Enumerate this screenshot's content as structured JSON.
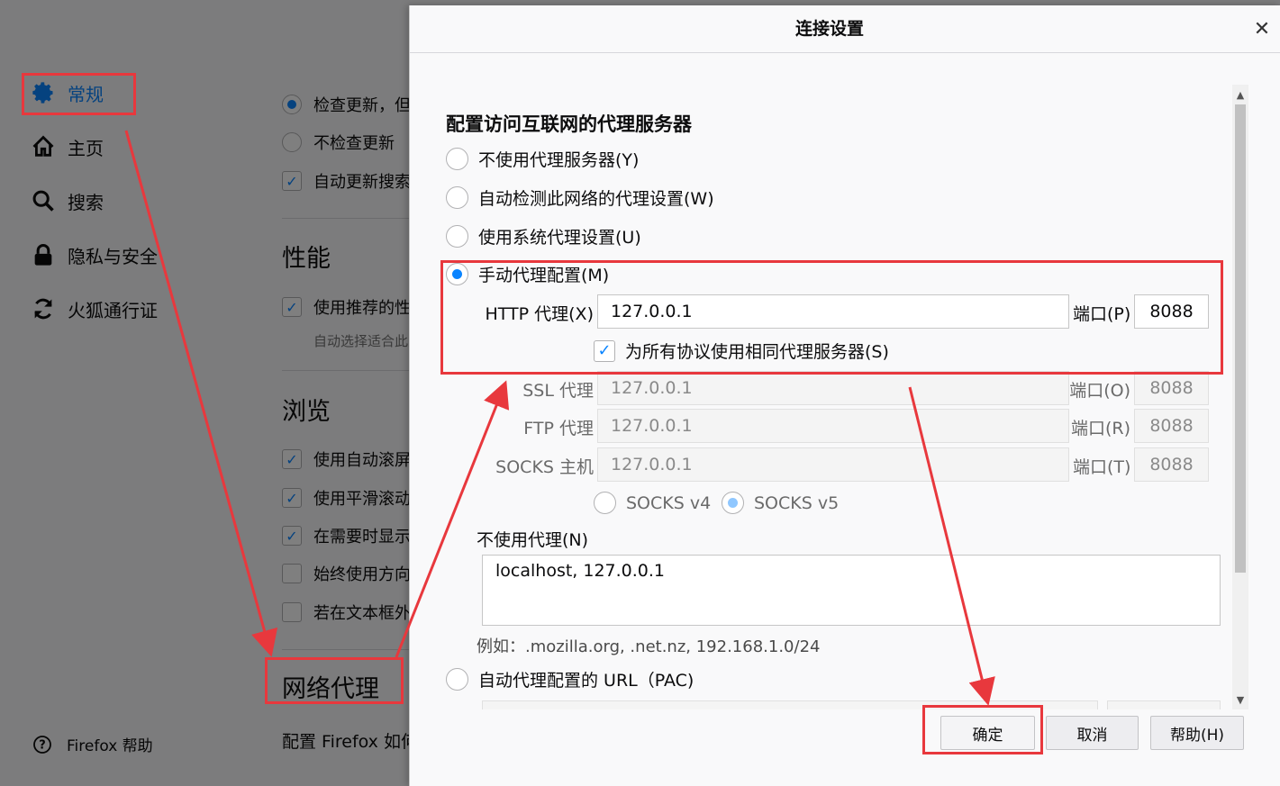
{
  "background": {
    "nav": [
      {
        "label": "常规",
        "icon": "gear-icon",
        "selected": true
      },
      {
        "label": "主页",
        "icon": "home-icon"
      },
      {
        "label": "搜索",
        "icon": "search-icon"
      },
      {
        "label": "隐私与安全",
        "icon": "lock-icon"
      },
      {
        "label": "火狐通行证",
        "icon": "sync-icon"
      }
    ],
    "help": "Firefox 帮助",
    "updates": {
      "opt1": "检查更新，但",
      "opt2": "不检查更新",
      "opt3": "自动更新搜索"
    },
    "performance": {
      "title": "性能",
      "opt1": "使用推荐的性",
      "sub": "自动选择适合此"
    },
    "browsing": {
      "title": "浏览",
      "opt1": "使用自动滚屏",
      "opt2": "使用平滑滚动",
      "opt3": "在需要时显示",
      "opt4": "始终使用方向",
      "opt5": "若在文本框外"
    },
    "proxy": {
      "title": "网络代理",
      "desc": "配置 Firefox 如何"
    }
  },
  "dialog": {
    "title": "连接设置",
    "heading": "配置访问互联网的代理服务器",
    "no_proxy": "不使用代理服务器(Y)",
    "auto_detect": "自动检测此网络的代理设置(W)",
    "system_proxy": "使用系统代理设置(U)",
    "manual_proxy": "手动代理配置(M)",
    "http_label": "HTTP 代理(X)",
    "http_value": "127.0.0.1",
    "port_p_label": "端口(P)",
    "http_port": "8088",
    "same_proxy": "为所有协议使用相同代理服务器(S)",
    "ssl_label": "SSL 代理",
    "ssl_value": "127.0.0.1",
    "port_o_label": "端口(O)",
    "ssl_port": "8088",
    "ftp_label": "FTP 代理",
    "ftp_value": "127.0.0.1",
    "port_r_label": "端口(R)",
    "ftp_port": "8088",
    "socks_label": "SOCKS 主机",
    "socks_value": "127.0.0.1",
    "port_t_label": "端口(T)",
    "socks_port": "8088",
    "socks_v4": "SOCKS v4",
    "socks_v5": "SOCKS v5",
    "no_proxy_for_label": "不使用代理(N)",
    "no_proxy_for_value": "localhost, 127.0.0.1",
    "example": "例如：.mozilla.org, .net.nz, 192.168.1.0/24",
    "pac_url": "自动代理配置的 URL（PAC)",
    "ok": "确定",
    "cancel": "取消",
    "help": "帮助(H)"
  },
  "colors": {
    "accent": "#0a84ff",
    "annotation": "#e8383d"
  }
}
